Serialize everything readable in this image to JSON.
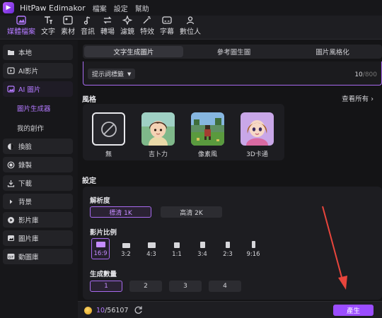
{
  "app": {
    "title": "HitPaw Edimakor"
  },
  "menubar": {
    "items": [
      "檔案",
      "設定",
      "幫助"
    ]
  },
  "toolbar": {
    "items": [
      {
        "label": "媒體檔案",
        "icon": "media-icon",
        "active": true
      },
      {
        "label": "文字",
        "icon": "text-icon"
      },
      {
        "label": "素材",
        "icon": "elements-icon"
      },
      {
        "label": "音訊",
        "icon": "music-icon"
      },
      {
        "label": "轉場",
        "icon": "transition-icon"
      },
      {
        "label": "濾鏡",
        "icon": "filter-icon"
      },
      {
        "label": "特效",
        "icon": "effects-icon"
      },
      {
        "label": "字幕",
        "icon": "subtitle-icon"
      },
      {
        "label": "數位人",
        "icon": "avatar-icon"
      }
    ]
  },
  "sidebar": {
    "items": [
      {
        "label": "本地",
        "icon": "folder-icon"
      },
      {
        "label": "AI影片",
        "icon": "ai-video-icon"
      },
      {
        "label": "AI 圖片",
        "icon": "ai-image-icon",
        "active": true
      },
      {
        "label": "換臉",
        "icon": "face-swap-icon"
      },
      {
        "label": "錄製",
        "icon": "record-icon"
      },
      {
        "label": "下載",
        "icon": "download-icon"
      },
      {
        "label": "背景",
        "icon": "background-icon"
      },
      {
        "label": "影片庫",
        "icon": "video-library-icon"
      },
      {
        "label": "圖片庫",
        "icon": "image-library-icon"
      },
      {
        "label": "動圖庫",
        "icon": "gif-library-icon"
      }
    ],
    "subitems": [
      {
        "label": "圖片生成器",
        "active": true
      },
      {
        "label": "我的創作"
      }
    ]
  },
  "tabs": [
    "文字生成圖片",
    "參考圖生圖",
    "圖片風格化"
  ],
  "prompt": {
    "button_label": "提示詞標籤",
    "count": "10",
    "max": "/800"
  },
  "style": {
    "heading": "風格",
    "view_all": "查看所有",
    "cards": [
      {
        "label": "無",
        "selected": true
      },
      {
        "label": "吉卜力"
      },
      {
        "label": "像素風"
      },
      {
        "label": "3D卡通"
      }
    ]
  },
  "settings": {
    "heading": "設定",
    "resolution": {
      "label": "解析度",
      "options": [
        "標清 1K",
        "高清 2K"
      ],
      "selected": 0
    },
    "aspect": {
      "label": "影片比例",
      "options": [
        "16:9",
        "3:2",
        "4:3",
        "1:1",
        "3:4",
        "2:3",
        "9:16"
      ],
      "selected": 0
    },
    "count": {
      "label": "生成數量",
      "options": [
        "1",
        "2",
        "3",
        "4"
      ],
      "selected": 0
    }
  },
  "bottombar": {
    "credits_used": "10",
    "credits_total": "/56107",
    "generate_label": "產生"
  },
  "colors": {
    "accent": "#9b4dff",
    "accent_text": "#b379ff",
    "annotation_arrow": "#e8453c"
  }
}
